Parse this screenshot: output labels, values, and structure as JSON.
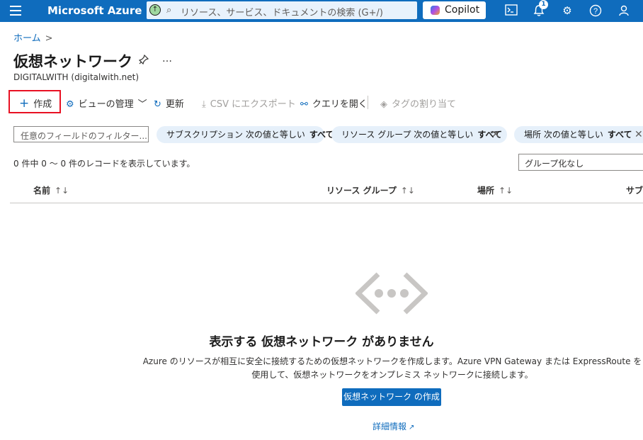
{
  "topbar": {
    "brand": "Microsoft Azure",
    "search_placeholder": "リソース、サービス、ドキュメントの検索 (G+/)",
    "copilot_label": "Copilot",
    "notification_count": "1"
  },
  "breadcrumb": {
    "home": "ホーム",
    "sep": ">"
  },
  "page": {
    "title": "仮想ネットワーク",
    "subtitle": "DIGITALWITH (digitalwith.net)",
    "more": "…"
  },
  "commands": {
    "create": "作成",
    "manage_view": "ビューの管理",
    "refresh": "更新",
    "export_csv": "CSV にエクスポート",
    "open_query": "クエリを開く",
    "assign_tags": "タグの割り当て"
  },
  "filters": {
    "placeholder": "任意のフィールドのフィルター...",
    "pills": [
      {
        "label": "サブスクリプション 次の値と等しい",
        "value": "すべて"
      },
      {
        "label": "リソース グループ 次の値と等しい",
        "value": "すべて"
      },
      {
        "label": "場所 次の値と等しい",
        "value": "すべて"
      }
    ]
  },
  "records_text": "0 件中 0 ～ 0 件のレコードを表示しています。",
  "grouping": "グループ化なし",
  "columns": [
    "名前",
    "リソース グループ",
    "場所",
    "サブ"
  ],
  "sort_glyph": "↑↓",
  "empty": {
    "title": "表示する 仮想ネットワーク がありません",
    "description_line1": "Azure のリソースが相互に安全に接続するための仮想ネットワークを作成します。Azure VPN Gateway または ExpressRoute を",
    "description_line2": "使用して、仮想ネットワークをオンプレミス ネットワークに接続します。",
    "create_button": "仮想ネットワーク の作成",
    "learn_more": "詳細情報"
  },
  "colors": {
    "accent": "#0f6cbd",
    "highlight": "#e81123",
    "pill_bg": "#e6f0fa"
  }
}
